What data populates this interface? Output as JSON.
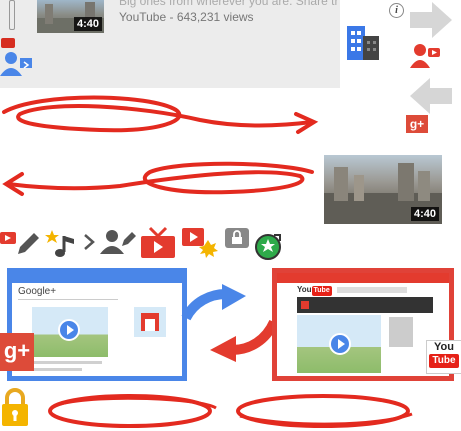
{
  "video_card": {
    "duration": "4:40",
    "description": "Big ones from wherever you are. Share them",
    "meta": "YouTube - 643,231 views",
    "info_glyph": "i"
  },
  "second_thumb": {
    "duration": "4:40"
  },
  "gplus_window": {
    "label": "Google+"
  },
  "gplus_badge": "g+",
  "gplus_small": "g+",
  "youtube_window": {
    "logo_text": "You",
    "logo_tube": "Tube"
  },
  "youtube_big": {
    "you": "You",
    "tube": "Tube"
  },
  "colors": {
    "red": "#e33b2e",
    "blue": "#4a86e8",
    "grey": "#d8d8d8",
    "green": "#2eaa4a"
  },
  "icons": [
    "youtube-play-icon",
    "person-share-icon",
    "buildings-icon",
    "arrow-right-icon",
    "arrow-left-icon",
    "person-video-icon",
    "pencil-icon",
    "stars-music-icon",
    "chevron-right-icon",
    "person-edit-icon",
    "tv-icon",
    "video-burst-icon",
    "lock-tab-icon",
    "green-star-badge-icon",
    "padlock-icon"
  ]
}
